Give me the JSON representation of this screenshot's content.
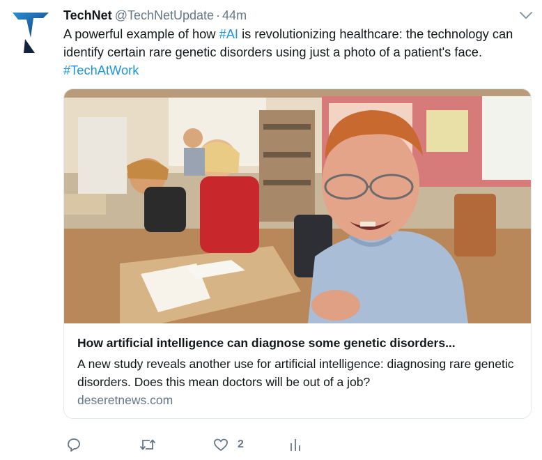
{
  "tweet": {
    "display_name": "TechNet",
    "handle": "@TechNetUpdate",
    "separator": "·",
    "time": "44m",
    "text_part1": "A powerful example of how ",
    "hashtag_ai": "#AI",
    "text_part2": " is revolutionizing healthcare: the technology can identify certain rare genetic disorders using just a photo of a patient's face. ",
    "hashtag_techatwork": "#TechAtWork"
  },
  "card": {
    "title": "How artificial intelligence can diagnose some genetic disorders...",
    "description": "A new study reveals another use for artificial intelligence: diagnosing rare genetic disorders. Does this mean doctors will be out of a job?",
    "domain": "deseretnews.com"
  },
  "actions": {
    "reply_icon": "reply-icon",
    "retweet_icon": "retweet-icon",
    "like_icon": "heart-icon",
    "like_count": "2",
    "analytics_icon": "analytics-icon"
  },
  "colors": {
    "link": "#1b95e0",
    "secondary_text": "#657786",
    "primary_text": "#14171a",
    "border": "#e1e8ed",
    "logo_blue": "#1a75c4",
    "logo_navy": "#14233d"
  }
}
